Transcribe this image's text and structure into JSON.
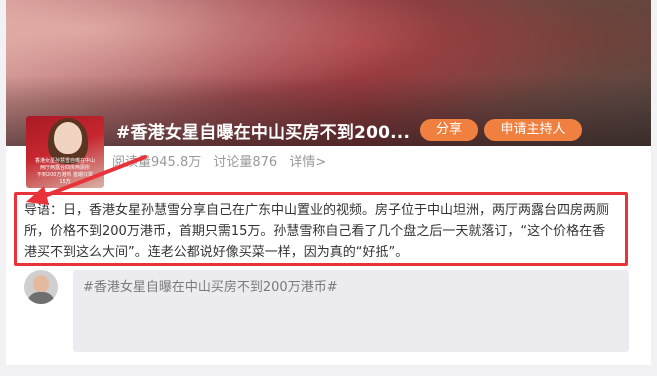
{
  "topic": {
    "title": "#香港女星自曝在中山买房不到200...",
    "thumbnail_caption": [
      "香港女星孙慧雪自曝在中山",
      "两厅两露台四房两厕所",
      "不到200万港币 首期只需",
      "15万"
    ]
  },
  "actions": {
    "share_label": "分享",
    "apply_host_label": "申请主持人"
  },
  "stats": {
    "reads": "阅读量945.8万",
    "discussions": "讨论量876",
    "details": "详情>"
  },
  "lead": {
    "text": "导语：日，香港女星孙慧雪分享自己在广东中山置业的视频。房子位于中山坦洲，两厅两露台四房两厕所，价格不到200万港币，首期只需15万。孙慧雪称自己看了几个盘之后一天就落订，“这个价格在香港买不到这么大间”。连老公都说好像买菜一样，因为真的“好抵”。"
  },
  "comment": {
    "placeholder_text": "#香港女星自曝在中山买房不到200万港币#"
  },
  "colors": {
    "accent_orange": "#f08040",
    "highlight_red": "#e8333b",
    "muted_text": "#999999"
  }
}
